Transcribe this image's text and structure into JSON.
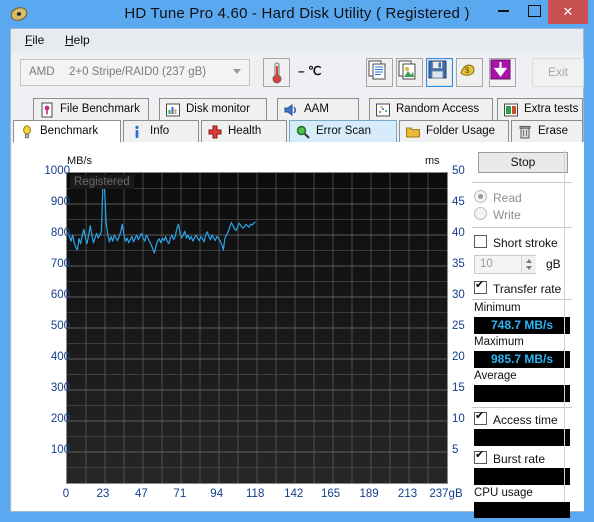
{
  "window": {
    "title": "HD Tune Pro 4.60 - Hard Disk Utility (  Registered )",
    "icon": "hdtune-logo-icon",
    "minimize": "–",
    "maximize": "□",
    "close": "✕",
    "titlebar_color": "#5aa9f0",
    "close_color": "#c75050"
  },
  "menu": {
    "items": [
      {
        "label": "File",
        "mnemonic": "F"
      },
      {
        "label": "Help",
        "mnemonic": "H"
      }
    ]
  },
  "toolbar": {
    "drive": {
      "vendor": "AMD",
      "model": "2+0 Stripe/RAID0 (237 gB)",
      "disabled": true
    },
    "temperature": "– ℃",
    "buttons": [
      {
        "name": "copy-text-icon",
        "title": "Copy text"
      },
      {
        "name": "copy-image-icon",
        "title": "Copy image"
      },
      {
        "name": "save-icon",
        "title": "Save",
        "focused": true
      },
      {
        "name": "shop-icon",
        "title": "Buy"
      },
      {
        "name": "download-icon",
        "title": "Download"
      }
    ],
    "exit_label": "Exit"
  },
  "tabs": {
    "row1": [
      {
        "label": "File Benchmark",
        "icon": "file-benchmark-icon",
        "state": "normal"
      },
      {
        "label": "Disk monitor",
        "icon": "disk-monitor-icon",
        "state": "normal"
      },
      {
        "label": "AAM",
        "icon": "speaker-icon",
        "state": "normal"
      },
      {
        "label": "Random Access",
        "icon": "random-access-icon",
        "state": "normal"
      },
      {
        "label": "Extra tests",
        "icon": "extra-tests-icon",
        "state": "normal"
      }
    ],
    "row2": [
      {
        "label": "Benchmark",
        "icon": "bulb-icon",
        "state": "selected"
      },
      {
        "label": "Info",
        "icon": "info-icon",
        "state": "normal"
      },
      {
        "label": "Health",
        "icon": "health-cross-icon",
        "state": "normal"
      },
      {
        "label": "Error Scan",
        "icon": "magnifier-icon",
        "state": "highlight"
      },
      {
        "label": "Folder Usage",
        "icon": "folder-icon",
        "state": "normal"
      },
      {
        "label": "Erase",
        "icon": "trash-icon",
        "state": "normal"
      }
    ]
  },
  "side": {
    "stop_label": "Stop",
    "mode": [
      {
        "label": "Read",
        "selected": true,
        "disabled": true
      },
      {
        "label": "Write",
        "selected": false,
        "disabled": true
      }
    ],
    "short_stroke": {
      "label": "Short stroke",
      "checked": false,
      "value": "10",
      "unit": "gB"
    },
    "transfer_rate": {
      "label": "Transfer rate",
      "checked": true
    },
    "minimum": {
      "label": "Minimum",
      "value": "748.7 MB/s"
    },
    "maximum": {
      "label": "Maximum",
      "value": "985.7 MB/s"
    },
    "average": {
      "label": "Average",
      "value": ""
    },
    "access_time": {
      "label": "Access time",
      "checked": true,
      "value": ""
    },
    "burst_rate": {
      "label": "Burst rate",
      "checked": true,
      "value": ""
    },
    "cpu_usage": {
      "label": "CPU usage",
      "value": ""
    },
    "value_color": "#29b6f6"
  },
  "chart_data": {
    "type": "line",
    "title": "",
    "watermark": "Registered",
    "xlabel": "",
    "ylabel": "MB/s",
    "y2label": "ms",
    "xlim": [
      0,
      237
    ],
    "ylim": [
      0,
      1000
    ],
    "y2lim": [
      0,
      50
    ],
    "grid": true,
    "legend": "none",
    "xticks": [
      0,
      23,
      47,
      71,
      94,
      118,
      142,
      165,
      189,
      213,
      237
    ],
    "xticklabels": [
      "0",
      "23",
      "47",
      "71",
      "94",
      "118",
      "142",
      "165",
      "189",
      "213",
      "237gB"
    ],
    "yticks": [
      100,
      200,
      300,
      400,
      500,
      600,
      700,
      800,
      900,
      1000
    ],
    "y2ticks": [
      5,
      10,
      15,
      20,
      25,
      30,
      35,
      40,
      45,
      50
    ],
    "series": [
      {
        "name": "Transfer rate",
        "color": "#2aa4e8",
        "units": "MB/s",
        "x": [
          0.5,
          1.5,
          2.5,
          3.5,
          4.5,
          5.5,
          6.5,
          7.5,
          8.5,
          9.5,
          10.5,
          11.5,
          12.5,
          13.5,
          14.5,
          15.5,
          16.5,
          17.5,
          18.5,
          19.5,
          20.5,
          21.5,
          22.5,
          23.5,
          24.5,
          25.5,
          26.5,
          27.5,
          28.5,
          29.5,
          30.5,
          31.5,
          32.5,
          33.5,
          34.5,
          35.5,
          36.5,
          37.5,
          38.5,
          39.5,
          40.5,
          41.5,
          42.5,
          43.5,
          44.5,
          45.5,
          46.5,
          47.5,
          48.5,
          49.5,
          50.5,
          51.5,
          52.5,
          53.5,
          54.5,
          55.5,
          56.5,
          57.5,
          58.5,
          59.5,
          60.5,
          61.5,
          62.5,
          63.5,
          64.5,
          65.5,
          66.5,
          67.5,
          68.5,
          69.5,
          70.5,
          71.5,
          72.5,
          73.5,
          74.5,
          75.5,
          76.5,
          77.5,
          78.5,
          79.5,
          80.5,
          81.5,
          82.5,
          83.5,
          84.5,
          85.5,
          86.5,
          87.5,
          88.5,
          89.5,
          90.5,
          91.5,
          92.5,
          93.5,
          94.5,
          95.5,
          96.5,
          97.5,
          98.5,
          99.5,
          100.5,
          101.5,
          102.5,
          103.5,
          104.5,
          105.5,
          106.5,
          107.5,
          108.5,
          109.5,
          110.5,
          111.5,
          112.5,
          113.5,
          114.5,
          115.5,
          116.5,
          117.5
        ],
        "y": [
          808,
          795,
          780,
          800,
          775,
          760,
          752,
          788,
          772,
          798,
          818,
          790,
          772,
          800,
          830,
          800,
          775,
          790,
          805,
          790,
          800,
          812,
          985,
          940,
          835,
          800,
          778,
          795,
          780,
          800,
          790,
          782,
          795,
          810,
          835,
          800,
          780,
          790,
          775,
          785,
          795,
          778,
          790,
          800,
          785,
          795,
          805,
          790,
          780,
          800,
          790,
          778,
          770,
          755,
          742,
          765,
          780,
          788,
          775,
          790,
          782,
          795,
          780,
          772,
          790,
          800,
          785,
          795,
          820,
          835,
          805,
          790,
          800,
          812,
          790,
          800,
          785,
          795,
          780,
          790,
          800,
          790,
          782,
          795,
          788,
          778,
          800,
          810,
          795,
          785,
          800,
          790,
          782,
          795,
          790,
          780,
          770,
          752,
          790,
          800,
          810,
          825,
          840,
          830,
          820,
          815,
          828,
          838,
          830,
          822,
          826,
          834,
          830,
          825,
          835,
          832,
          838,
          842
        ]
      }
    ]
  }
}
